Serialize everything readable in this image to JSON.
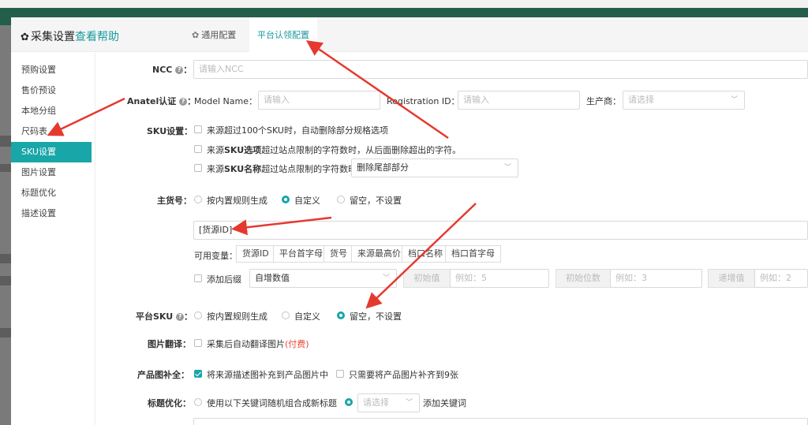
{
  "dialog": {
    "title": "采集设置",
    "help_link": "查看帮助",
    "tabs": {
      "general": "通用配置",
      "platform": "平台认领配置"
    }
  },
  "sidebar": {
    "items": [
      {
        "label": "预购设置",
        "active": false
      },
      {
        "label": "售价预设",
        "active": false
      },
      {
        "label": "本地分组",
        "active": false
      },
      {
        "label": "尺码表",
        "active": false
      },
      {
        "label": "SKU设置",
        "active": true
      },
      {
        "label": "图片设置",
        "active": false
      },
      {
        "label": "标题优化",
        "active": false
      },
      {
        "label": "描述设置",
        "active": false
      }
    ]
  },
  "form": {
    "ncc": {
      "label": "NCC",
      "placeholder": "请输入NCC"
    },
    "anatel": {
      "label": "Anatel认证",
      "model_label": "Model Name：",
      "model_placeholder": "请输入",
      "reg_label": "Registration ID：",
      "reg_placeholder": "请输入",
      "maker_label": "生产商：",
      "maker_placeholder": "请选择"
    },
    "sku_settings": {
      "label": "SKU设置：",
      "opt1": "来源超过100个SKU时，自动删除部分规格选项",
      "opt2_pre": "来源",
      "opt2_bold": "SKU选项",
      "opt2_post": "超过站点限制的字符数时，从后面删除超出的字符。",
      "opt3_pre": "来源",
      "opt3_bold": "SKU名称",
      "opt3_post": "超过站点限制的字符数时，",
      "opt3_select": "删除尾部部分"
    },
    "main_sku": {
      "label": "主货号：",
      "radio1": "按内置规则生成",
      "radio2": "自定义",
      "radio3": "留空，不设置",
      "selected": "自定义",
      "value": "[货源ID]",
      "vars_label": "可用变量：",
      "vars": [
        "货源ID",
        "平台首字母",
        "货号",
        "来源最高价",
        "档口名称",
        "档口首字母"
      ],
      "suffix_label": "添加后缀",
      "suffix_select": "自增数值",
      "initial_value_label": "初始值",
      "initial_value_placeholder": "例如：5",
      "initial_digits_label": "初始位数",
      "initial_digits_placeholder": "例如：3",
      "increment_label": "递增值",
      "increment_placeholder": "例如：2"
    },
    "platform_sku": {
      "label": "平台SKU",
      "radio1": "按内置规则生成",
      "radio2": "自定义",
      "radio3": "留空，不设置",
      "selected": "留空，不设置"
    },
    "image_translate": {
      "label": "图片翻译：",
      "opt": "采集后自动翻译图片",
      "paid": "(付费)"
    },
    "image_fill": {
      "label": "产品图补全：",
      "opt1": "将来源描述图补充到产品图片中",
      "opt1_checked": true,
      "opt2": "只需要将产品图片补齐到9张",
      "opt2_checked": false
    },
    "title_opt": {
      "label": "标题优化：",
      "radio1": "使用以下关键词随机组合成新标题",
      "select_placeholder": "请选择",
      "add_keyword": "添加关键词"
    }
  },
  "colors": {
    "accent": "#19a6a8",
    "annotation_arrow": "#e5392f",
    "paid_text": "#e54a3a"
  }
}
